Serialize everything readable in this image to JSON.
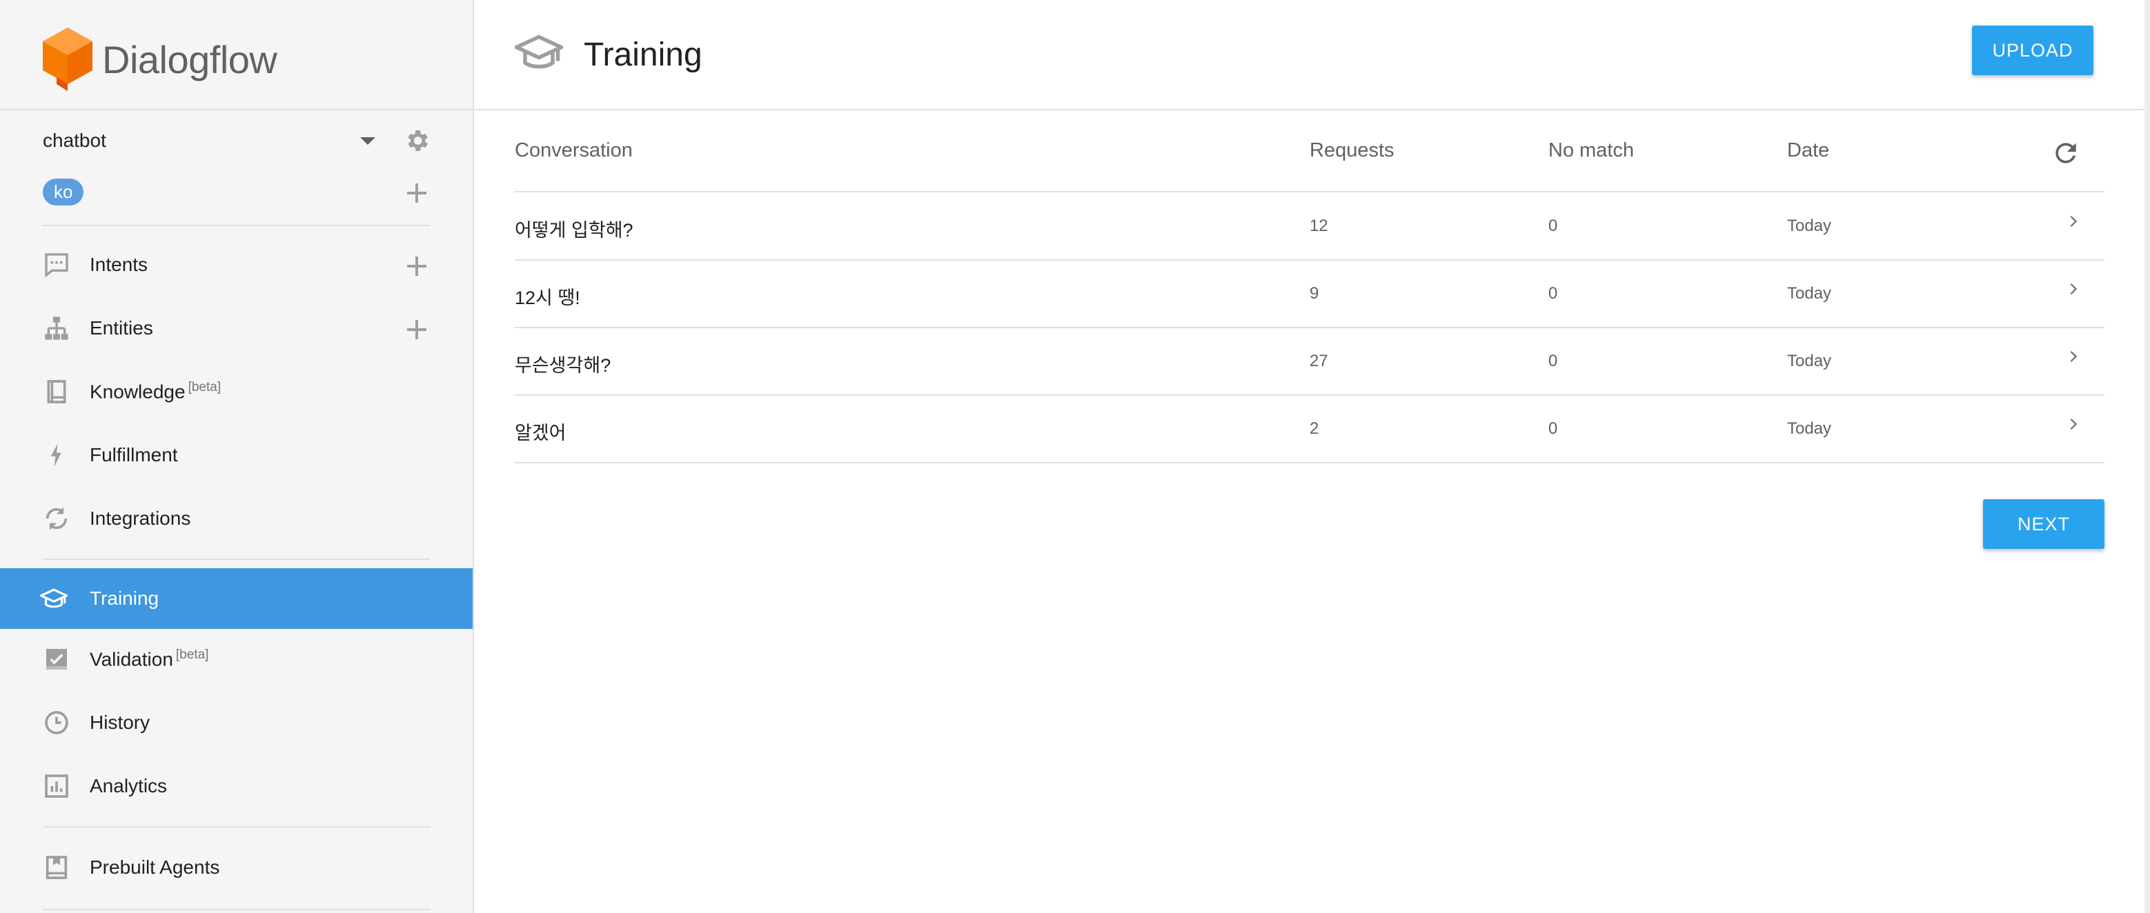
{
  "app": {
    "logo_text": "Dialogflow"
  },
  "sidebar": {
    "agent_name": "chatbot",
    "language": "ko",
    "items": [
      {
        "label": "Intents",
        "beta": ""
      },
      {
        "label": "Entities",
        "beta": ""
      },
      {
        "label": "Knowledge",
        "beta": "[beta]"
      },
      {
        "label": "Fulfillment",
        "beta": ""
      },
      {
        "label": "Integrations",
        "beta": ""
      },
      {
        "label": "Training",
        "beta": ""
      },
      {
        "label": "Validation",
        "beta": "[beta]"
      },
      {
        "label": "History",
        "beta": ""
      },
      {
        "label": "Analytics",
        "beta": ""
      },
      {
        "label": "Prebuilt Agents",
        "beta": ""
      }
    ],
    "active_item": "Training"
  },
  "header": {
    "title": "Training",
    "upload_label": "UPLOAD"
  },
  "table": {
    "columns": [
      "Conversation",
      "Requests",
      "No match",
      "Date"
    ],
    "rows": [
      {
        "conversation": "어떻게 입학해?",
        "requests": "12",
        "no_match": "0",
        "date": "Today"
      },
      {
        "conversation": "12시 땡!",
        "requests": "9",
        "no_match": "0",
        "date": "Today"
      },
      {
        "conversation": "무슨생각해?",
        "requests": "27",
        "no_match": "0",
        "date": "Today"
      },
      {
        "conversation": "알겠어",
        "requests": "2",
        "no_match": "0",
        "date": "Today"
      }
    ]
  },
  "pagination": {
    "next_label": "NEXT"
  },
  "colors": {
    "accent": "#29a3ee",
    "active_nav": "#3e97e0",
    "logo_orange": "#f57c00"
  }
}
